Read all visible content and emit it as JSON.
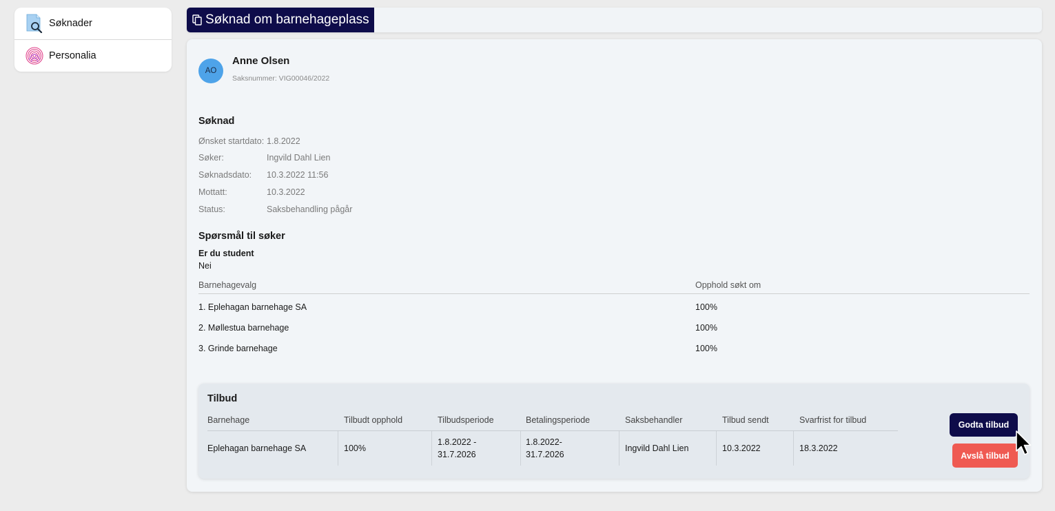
{
  "sidebar": {
    "items": [
      {
        "label": "Søknader",
        "icon": "document-search-icon"
      },
      {
        "label": "Personalia",
        "icon": "fingerprint-icon"
      }
    ]
  },
  "header": {
    "title": "Søknad om barnehageplass",
    "icon": "copy-icon"
  },
  "applicant": {
    "initials": "AO",
    "name": "Anne Olsen",
    "case_number": "Saksnummer: VIG00046/2022"
  },
  "application": {
    "title": "Søknad",
    "details": [
      {
        "label": "Ønsket startdato:",
        "value": "1.8.2022"
      },
      {
        "label": "Søker:",
        "value": "Ingvild Dahl Lien"
      },
      {
        "label": "Søknadsdato:",
        "value": "10.3.2022 11:56"
      },
      {
        "label": "Mottatt:",
        "value": "10.3.2022"
      },
      {
        "label": "Status:",
        "value": "Saksbehandling pågår"
      }
    ]
  },
  "questions": {
    "title": "Spørsmål til søker",
    "question": "Er du student",
    "answer": "Nei"
  },
  "choices": {
    "headers": [
      "Barnehagevalg",
      "Opphold søkt om"
    ],
    "rows": [
      [
        "1. Eplehagan barnehage SA",
        "100%"
      ],
      [
        "2. Møllestua barnehage",
        "100%"
      ],
      [
        "3. Grinde barnehage",
        "100%"
      ]
    ]
  },
  "offer": {
    "title": "Tilbud",
    "headers": [
      "Barnehage",
      "Tilbudt opphold",
      "Tilbudsperiode",
      "Betalingsperiode",
      "Saksbehandler",
      "Tilbud sendt",
      "Svarfrist for tilbud"
    ],
    "row": {
      "kindergarten": "Eplehagan barnehage SA",
      "offered_stay": "100%",
      "offer_period_1": "1.8.2022 -",
      "offer_period_2": "31.7.2026",
      "payment_period_1": "1.8.2022-",
      "payment_period_2": "31.7.2026",
      "case_handler": "Ingvild Dahl Lien",
      "offer_sent": "10.3.2022",
      "deadline": "18.3.2022"
    },
    "accept_label": "Godta tilbud",
    "decline_label": "Avslå tilbud"
  },
  "colors": {
    "primary": "#0e0c4a",
    "danger": "#ef5a52",
    "avatar": "#4ea3e9"
  }
}
